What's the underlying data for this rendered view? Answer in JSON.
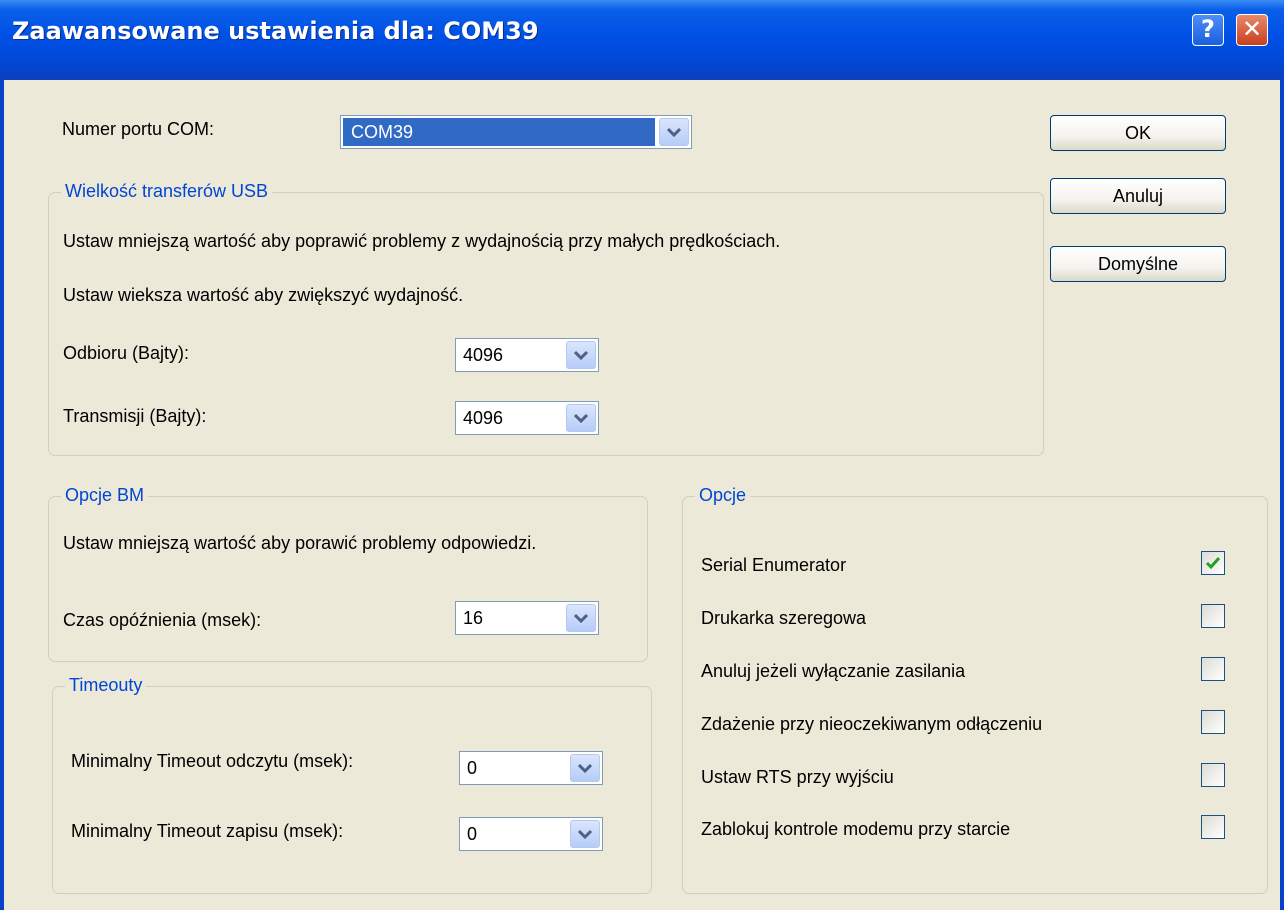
{
  "window": {
    "title": "Zaawansowane ustawienia dla: COM39",
    "help_glyph": "?",
    "close_glyph": "✕"
  },
  "port": {
    "label": "Numer portu COM:",
    "value": "COM39"
  },
  "buttons": {
    "ok": "OK",
    "cancel": "Anuluj",
    "defaults": "Domyślne"
  },
  "usb": {
    "title": "Wielkość transferów USB",
    "line1": "Ustaw mniejszą wartość aby poprawić problemy z wydajnością przy małych prędkościach.",
    "line2": "Ustaw wieksza wartość aby zwiększyć wydajność.",
    "receive_label": "Odbioru (Bajty):",
    "receive_value": "4096",
    "transmit_label": "Transmisji (Bajty):",
    "transmit_value": "4096"
  },
  "bm": {
    "title": "Opcje BM",
    "desc": "Ustaw mniejszą wartość aby porawić problemy odpowiedzi.",
    "latency_label": "Czas opóźnienia (msek):",
    "latency_value": "16"
  },
  "timeouts": {
    "title": "Timeouty",
    "read_label": "Minimalny Timeout odczytu (msek):",
    "read_value": "0",
    "write_label": "Minimalny Timeout zapisu (msek):",
    "write_value": "0"
  },
  "options": {
    "title": "Opcje",
    "items": [
      {
        "label": "Serial Enumerator",
        "checked": true
      },
      {
        "label": "Drukarka szeregowa",
        "checked": false
      },
      {
        "label": "Anuluj jeżeli wyłączanie zasilania",
        "checked": false
      },
      {
        "label": "Zdażenie przy nieoczekiwanym odłączeniu",
        "checked": false
      },
      {
        "label": "Ustaw RTS przy wyjściu",
        "checked": false
      },
      {
        "label": "Zablokuj kontrole modemu przy starcie",
        "checked": false
      }
    ]
  },
  "colors": {
    "title_bar": "#0054e3",
    "dialog_bg": "#ece9d8",
    "group_title": "#0046d5",
    "selection": "#316ac5",
    "check": "#21a121"
  },
  "icons": {
    "help": "help-icon",
    "close": "close-icon",
    "dropdown": "chevron-down-icon",
    "check": "checkmark-icon"
  }
}
